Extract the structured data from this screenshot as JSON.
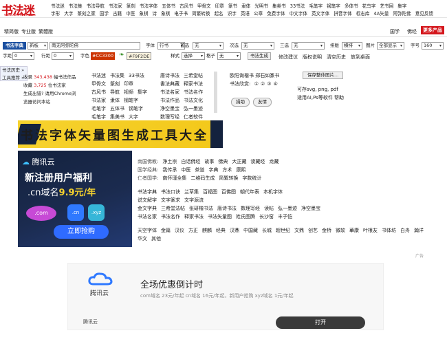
{
  "header": {
    "logo_text": "书法迷",
    "logo_url": "www.shufami.com",
    "nav_row1": [
      "书法迷",
      "书法集",
      "书法导航",
      "书法家",
      "篆刻",
      "书法字体",
      "五体书",
      "古风书",
      "甲骨文",
      "印章",
      "篆书",
      "隶体",
      "光明书",
      "集美书",
      "33书法",
      "毛笔字",
      "钢笔字",
      "多体书",
      "花鸟字",
      "艺书网",
      "集字"
    ],
    "nav_row2": [
      "字形",
      "大字",
      "篆刻之家",
      "国学",
      "古籍",
      "中医",
      "象棋",
      "诗",
      "象棋",
      "电子书",
      "简繁转换",
      "起名",
      "识字",
      "英语",
      "公章",
      "免费字体",
      "中文字体",
      "英文字体",
      "拼音字体",
      "标志库",
      "4A矢量",
      "阿弥陀佛",
      "意见反馈"
    ]
  },
  "bar2": {
    "left": [
      "精简版",
      "专业版",
      "繁體版"
    ],
    "right": [
      "国学",
      "佛经"
    ],
    "more_button": "更多产品"
  },
  "toolbar": {
    "row1": {
      "font_button": "书法字典",
      "style_select": "新板",
      "text_input": "南无阿弥陀佛",
      "font_label": "字体",
      "font_select": "行书",
      "head_label": "首选",
      "head_select": "无",
      "second_label": "次选",
      "second_select": "无",
      "third_label": "三选",
      "third_select": "无",
      "layout_label": "排版",
      "layout_select": "横排",
      "image_label": "图片",
      "image_select": "全部显示",
      "size_label": "字号",
      "size_select": "160"
    },
    "row2": {
      "char_spacing_label": "字距",
      "char_spacing_select": "0",
      "line_spacing_label": "行距",
      "line_spacing_select": "0",
      "color_label": "字色",
      "color_value": "#CC3300",
      "bg_value": "#F9F2DE",
      "style_label": "样式",
      "style_select": "选择",
      "grid_label": "格子",
      "grid_select": "无",
      "generate_button": "书法生成",
      "links": [
        "修改建议",
        "版权说明",
        "清空历史",
        "放到桌面"
      ]
    }
  },
  "left_panel": {
    "history_tab": "书法历史",
    "tools_tab": "工具推荐",
    "lines": [
      "收录 343,438 幅书法作品",
      "收藏 3,725 位书法家",
      "生成出错? 请用Chrome浏",
      "览器访问本站"
    ],
    "count1": "343,438",
    "count2": "3,725"
  },
  "link_columns": [
    [
      "书法迷",
      "书法集",
      "33书法"
    ],
    [
      "甲骨文",
      "篆刻",
      "印章"
    ],
    [
      "古风书",
      "导航",
      "视频",
      "集字"
    ],
    [
      "书法家",
      "隶体",
      "钢笔字"
    ],
    [
      "毛笔字",
      "五体书",
      "钢笔字"
    ],
    [
      "毛笔字",
      "集美书",
      "大字"
    ]
  ],
  "link_columns_b": [
    [
      "唐诗书法",
      "三希堂帖"
    ],
    [
      "書法典藏",
      "释家书法"
    ],
    [
      "书法名家",
      "书法名作"
    ],
    [
      "书法作品",
      "书法文化"
    ],
    [
      "净空墨宝",
      "弘一墨迹"
    ],
    [
      "数理写经",
      "仁者软件"
    ]
  ],
  "text_panel": {
    "line1": "欧阳询楷书  郑石如篆书",
    "line2_label": "书法欣赏:",
    "circles": [
      "①",
      "②",
      "③",
      "④"
    ],
    "donate_button": "捐助",
    "friend_button": "友情"
  },
  "save_panel": {
    "save_button": "保存整体图片...",
    "line1": "可存svg, png, pdf",
    "line2": "适用AI,Ps等软件  帮助"
  },
  "banner": {
    "title": "书法字体矢量图生成工具大全"
  },
  "ad_left": {
    "brand": "腾讯云",
    "headline": "新注册用户福利",
    "sub_prefix": ".cn域名",
    "sub_price": "9.9元/年",
    "tag_com": ".com",
    "tag_cn": ".cn",
    "tag_xyz": ".xyz",
    "cta": "立即抢购"
  },
  "right_links": {
    "row1": [
      "南国佛教:",
      "净土宗",
      "白话佛经",
      "故事",
      "佛典",
      "大正藏",
      "读藏经",
      "龙藏"
    ],
    "row2": [
      "国学经典:",
      "我传承",
      "中医",
      "茶道",
      "字典",
      "方术",
      "康熙"
    ],
    "row3": [
      "仁者国学:",
      "南怀瑾全集",
      "二维码生成",
      "简繁转换",
      "字数统计"
    ],
    "row4": [
      "书法字典",
      "书法口诀",
      "兰草集",
      "百福图",
      "百佛图",
      "朝代年表",
      "本机字体"
    ],
    "row5": [
      "说文解字",
      "文字篆求",
      "文字源流"
    ],
    "row6": [
      "金文字典",
      "三希堂法帖",
      "张研楷书法",
      "唐诗书法",
      "数理写经",
      "读帖",
      "弘一墨迹",
      "净空墨宝"
    ],
    "row7": [
      "书法名家",
      "书法名作",
      "释家书法",
      "书法矢量图",
      "姓氏图腾",
      "长沙窑",
      "丰子恺"
    ],
    "row8": [
      "天空字体",
      "金篇",
      "汉仪",
      "方正",
      "麒麟",
      "经典",
      "汉鼎",
      "中国藏",
      "长城",
      "超世纪",
      "文鼎",
      "创艺",
      "金桥",
      "微软",
      "華康",
      "叶根友",
      "书体坊",
      "白舟",
      "瀚洋"
    ],
    "row9": [
      "华文",
      "其他"
    ]
  },
  "ad_bottom": {
    "title": "全场优惠倒计时",
    "subtitle": "com域名 23元/年起 cn域名 16元/年起，新用户抢购 xyz域名 1元/年起",
    "brand": "腾讯云",
    "brand_footer": "腾讯云",
    "button": "打开",
    "ad_label": "广告"
  }
}
